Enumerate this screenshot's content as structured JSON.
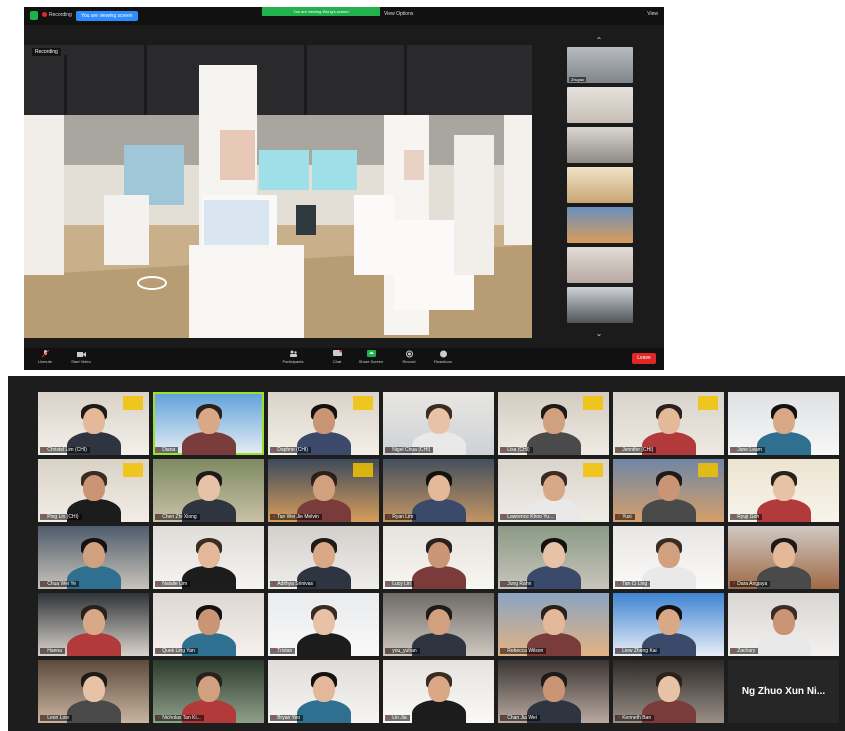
{
  "top_window": {
    "recording_label": "Recording",
    "pill_label": "You are viewing screen",
    "banner_text": "You are viewing Wong's screen",
    "view_options": "View Options",
    "view_button": "View",
    "speaker_label": "Recording",
    "strip_names": [
      "Zhuyao",
      "",
      "",
      "",
      "",
      "",
      ""
    ],
    "toolbar": {
      "unmute": "Unmute",
      "start_video": "Start Video",
      "participants": "Participants",
      "chat": "Chat",
      "share_screen": "Share Screen",
      "record": "Record",
      "reactions": "Reactions",
      "end": "Leave"
    }
  },
  "gallery": {
    "participants": [
      "Christel Lim (CHI)",
      "Diana",
      "Daphne (CHI)",
      "Nigel Chua (CHI)",
      "Lisa (CHI)",
      "Jennifer (CHI)",
      "Jane Leam",
      "Ping Lin (CHI)",
      "Chen Zhi Xiong",
      "Tan Wei Jie Melvin",
      "Ryan Lim",
      "Lawrence Khoo Yu...",
      "Yuxi",
      "Ryuji Goh",
      "Chua Wei Ye",
      "Natalie Lim",
      "Adithya Srinivas",
      "Lucy Lin",
      "Jung Rahn",
      "Tan Ci Ling",
      "Dara Angjaya",
      "Hanna",
      "Quek Ling Yan",
      "Tristan",
      "you_yuhan",
      "Rebecca Wilson",
      "Liew Zheng Kai",
      "Zachary",
      "Leon Low",
      "Nicholas Tan Ki...",
      "Bryan Yeo",
      "Lin Jia",
      "Chan Jia Wei",
      "Kenneth Ban",
      "Ng Zhuo Xun Ni..."
    ]
  }
}
